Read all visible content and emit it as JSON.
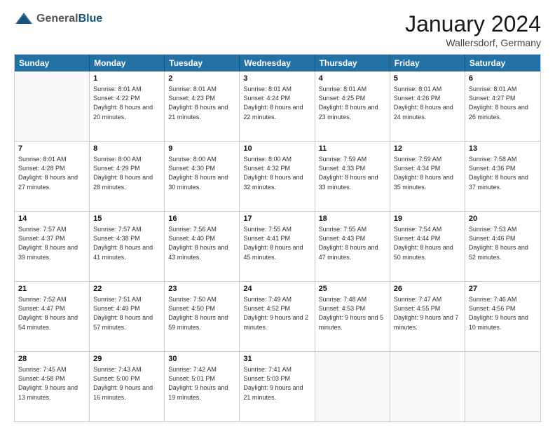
{
  "header": {
    "logo": {
      "general": "General",
      "blue": "Blue"
    },
    "month": "January 2024",
    "location": "Wallersdorf, Germany"
  },
  "weekdays": [
    "Sunday",
    "Monday",
    "Tuesday",
    "Wednesday",
    "Thursday",
    "Friday",
    "Saturday"
  ],
  "weeks": [
    [
      {
        "day": "",
        "empty": true
      },
      {
        "day": "1",
        "sunrise": "Sunrise: 8:01 AM",
        "sunset": "Sunset: 4:22 PM",
        "daylight": "Daylight: 8 hours and 20 minutes."
      },
      {
        "day": "2",
        "sunrise": "Sunrise: 8:01 AM",
        "sunset": "Sunset: 4:23 PM",
        "daylight": "Daylight: 8 hours and 21 minutes."
      },
      {
        "day": "3",
        "sunrise": "Sunrise: 8:01 AM",
        "sunset": "Sunset: 4:24 PM",
        "daylight": "Daylight: 8 hours and 22 minutes."
      },
      {
        "day": "4",
        "sunrise": "Sunrise: 8:01 AM",
        "sunset": "Sunset: 4:25 PM",
        "daylight": "Daylight: 8 hours and 23 minutes."
      },
      {
        "day": "5",
        "sunrise": "Sunrise: 8:01 AM",
        "sunset": "Sunset: 4:26 PM",
        "daylight": "Daylight: 8 hours and 24 minutes."
      },
      {
        "day": "6",
        "sunrise": "Sunrise: 8:01 AM",
        "sunset": "Sunset: 4:27 PM",
        "daylight": "Daylight: 8 hours and 26 minutes."
      }
    ],
    [
      {
        "day": "7",
        "sunrise": "Sunrise: 8:01 AM",
        "sunset": "Sunset: 4:28 PM",
        "daylight": "Daylight: 8 hours and 27 minutes."
      },
      {
        "day": "8",
        "sunrise": "Sunrise: 8:00 AM",
        "sunset": "Sunset: 4:29 PM",
        "daylight": "Daylight: 8 hours and 28 minutes."
      },
      {
        "day": "9",
        "sunrise": "Sunrise: 8:00 AM",
        "sunset": "Sunset: 4:30 PM",
        "daylight": "Daylight: 8 hours and 30 minutes."
      },
      {
        "day": "10",
        "sunrise": "Sunrise: 8:00 AM",
        "sunset": "Sunset: 4:32 PM",
        "daylight": "Daylight: 8 hours and 32 minutes."
      },
      {
        "day": "11",
        "sunrise": "Sunrise: 7:59 AM",
        "sunset": "Sunset: 4:33 PM",
        "daylight": "Daylight: 8 hours and 33 minutes."
      },
      {
        "day": "12",
        "sunrise": "Sunrise: 7:59 AM",
        "sunset": "Sunset: 4:34 PM",
        "daylight": "Daylight: 8 hours and 35 minutes."
      },
      {
        "day": "13",
        "sunrise": "Sunrise: 7:58 AM",
        "sunset": "Sunset: 4:36 PM",
        "daylight": "Daylight: 8 hours and 37 minutes."
      }
    ],
    [
      {
        "day": "14",
        "sunrise": "Sunrise: 7:57 AM",
        "sunset": "Sunset: 4:37 PM",
        "daylight": "Daylight: 8 hours and 39 minutes."
      },
      {
        "day": "15",
        "sunrise": "Sunrise: 7:57 AM",
        "sunset": "Sunset: 4:38 PM",
        "daylight": "Daylight: 8 hours and 41 minutes."
      },
      {
        "day": "16",
        "sunrise": "Sunrise: 7:56 AM",
        "sunset": "Sunset: 4:40 PM",
        "daylight": "Daylight: 8 hours and 43 minutes."
      },
      {
        "day": "17",
        "sunrise": "Sunrise: 7:55 AM",
        "sunset": "Sunset: 4:41 PM",
        "daylight": "Daylight: 8 hours and 45 minutes."
      },
      {
        "day": "18",
        "sunrise": "Sunrise: 7:55 AM",
        "sunset": "Sunset: 4:43 PM",
        "daylight": "Daylight: 8 hours and 47 minutes."
      },
      {
        "day": "19",
        "sunrise": "Sunrise: 7:54 AM",
        "sunset": "Sunset: 4:44 PM",
        "daylight": "Daylight: 8 hours and 50 minutes."
      },
      {
        "day": "20",
        "sunrise": "Sunrise: 7:53 AM",
        "sunset": "Sunset: 4:46 PM",
        "daylight": "Daylight: 8 hours and 52 minutes."
      }
    ],
    [
      {
        "day": "21",
        "sunrise": "Sunrise: 7:52 AM",
        "sunset": "Sunset: 4:47 PM",
        "daylight": "Daylight: 8 hours and 54 minutes."
      },
      {
        "day": "22",
        "sunrise": "Sunrise: 7:51 AM",
        "sunset": "Sunset: 4:49 PM",
        "daylight": "Daylight: 8 hours and 57 minutes."
      },
      {
        "day": "23",
        "sunrise": "Sunrise: 7:50 AM",
        "sunset": "Sunset: 4:50 PM",
        "daylight": "Daylight: 8 hours and 59 minutes."
      },
      {
        "day": "24",
        "sunrise": "Sunrise: 7:49 AM",
        "sunset": "Sunset: 4:52 PM",
        "daylight": "Daylight: 9 hours and 2 minutes."
      },
      {
        "day": "25",
        "sunrise": "Sunrise: 7:48 AM",
        "sunset": "Sunset: 4:53 PM",
        "daylight": "Daylight: 9 hours and 5 minutes."
      },
      {
        "day": "26",
        "sunrise": "Sunrise: 7:47 AM",
        "sunset": "Sunset: 4:55 PM",
        "daylight": "Daylight: 9 hours and 7 minutes."
      },
      {
        "day": "27",
        "sunrise": "Sunrise: 7:46 AM",
        "sunset": "Sunset: 4:56 PM",
        "daylight": "Daylight: 9 hours and 10 minutes."
      }
    ],
    [
      {
        "day": "28",
        "sunrise": "Sunrise: 7:45 AM",
        "sunset": "Sunset: 4:58 PM",
        "daylight": "Daylight: 9 hours and 13 minutes."
      },
      {
        "day": "29",
        "sunrise": "Sunrise: 7:43 AM",
        "sunset": "Sunset: 5:00 PM",
        "daylight": "Daylight: 9 hours and 16 minutes."
      },
      {
        "day": "30",
        "sunrise": "Sunrise: 7:42 AM",
        "sunset": "Sunset: 5:01 PM",
        "daylight": "Daylight: 9 hours and 19 minutes."
      },
      {
        "day": "31",
        "sunrise": "Sunrise: 7:41 AM",
        "sunset": "Sunset: 5:03 PM",
        "daylight": "Daylight: 9 hours and 21 minutes."
      },
      {
        "day": "",
        "empty": true
      },
      {
        "day": "",
        "empty": true
      },
      {
        "day": "",
        "empty": true
      }
    ]
  ]
}
